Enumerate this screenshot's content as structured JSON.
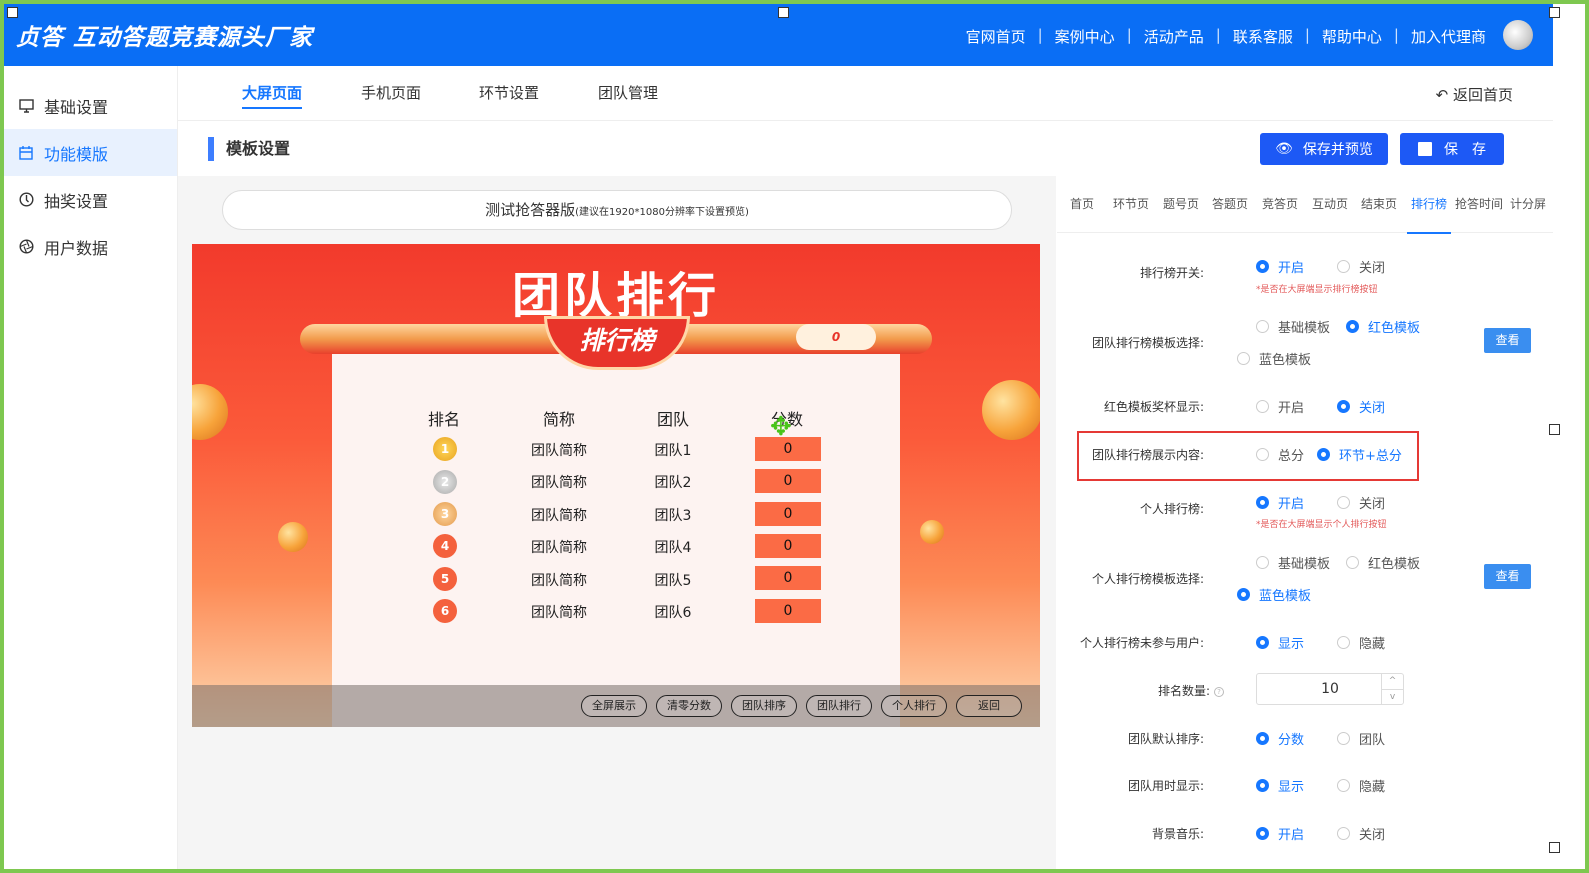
{
  "header": {
    "logo": "贞答 互动答题竞赛源头厂家",
    "nav": [
      "官网首页",
      "案例中心",
      "活动产品",
      "联系客服",
      "帮助中心",
      "加入代理商"
    ]
  },
  "sidebar": {
    "items": [
      {
        "label": "基础设置",
        "icon": "monitor-icon"
      },
      {
        "label": "功能模版",
        "icon": "calendar-icon"
      },
      {
        "label": "抽奖设置",
        "icon": "compass-icon"
      },
      {
        "label": "用户数据",
        "icon": "aperture-icon"
      }
    ]
  },
  "tabs": [
    "大屏页面",
    "手机页面",
    "环节设置",
    "团队管理"
  ],
  "back_label": "返回首页",
  "section_title": "模板设置",
  "buttons": {
    "save_preview": "保存并预览",
    "save": "保　存"
  },
  "preview": {
    "pill": "测试抢答器版",
    "pill_note": "(建议在1920*1080分辨率下设置预览)",
    "title": "团队排行",
    "badge": "排行榜",
    "oval": "0",
    "headers": [
      "排名",
      "简称",
      "团队",
      "分数"
    ],
    "rows": [
      {
        "rank": "1",
        "short": "团队简称",
        "team": "团队1",
        "score": "0"
      },
      {
        "rank": "2",
        "short": "团队简称",
        "team": "团队2",
        "score": "0"
      },
      {
        "rank": "3",
        "short": "团队简称",
        "team": "团队3",
        "score": "0"
      },
      {
        "rank": "4",
        "short": "团队简称",
        "team": "团队4",
        "score": "0"
      },
      {
        "rank": "5",
        "short": "团队简称",
        "team": "团队5",
        "score": "0"
      },
      {
        "rank": "6",
        "short": "团队简称",
        "team": "团队6",
        "score": "0"
      }
    ],
    "bottom_buttons": [
      "全屏展示",
      "清零分数",
      "团队排序",
      "团队排行",
      "个人排行",
      "返回"
    ]
  },
  "right_tabs": [
    "首页",
    "环节页",
    "题号页",
    "答题页",
    "竞答页",
    "互动页",
    "结束页",
    "排行榜",
    "抢答时间",
    "计分屏"
  ],
  "form": {
    "rank_switch": {
      "label": "排行榜开关:",
      "opts": [
        "开启",
        "关闭"
      ],
      "hint": "*是否在大屏端显示排行榜按钮"
    },
    "team_tpl": {
      "label": "团队排行榜模板选择:",
      "opts": [
        "基础模板",
        "红色模板",
        "蓝色模板"
      ],
      "view": "查看"
    },
    "red_cup": {
      "label": "红色模板奖杯显示:",
      "opts": [
        "开启",
        "关闭"
      ]
    },
    "team_content": {
      "label": "团队排行榜展示内容:",
      "opts": [
        "总分",
        "环节+总分"
      ]
    },
    "person_rank": {
      "label": "个人排行榜:",
      "opts": [
        "开启",
        "关闭"
      ],
      "hint": "*是否在大屏端显示个人排行按钮"
    },
    "person_tpl": {
      "label": "个人排行榜模板选择:",
      "opts": [
        "基础模板",
        "红色模板",
        "蓝色模板"
      ],
      "view": "查看"
    },
    "non_user": {
      "label": "个人排行榜未参与用户:",
      "opts": [
        "显示",
        "隐藏"
      ]
    },
    "rank_count": {
      "label": "排名数量:",
      "value": "10",
      "up": "^",
      "down": "v",
      "help": "?"
    },
    "team_sort": {
      "label": "团队默认排序:",
      "opts": [
        "分数",
        "团队"
      ]
    },
    "team_time": {
      "label": "团队用时显示:",
      "opts": [
        "显示",
        "隐藏"
      ]
    },
    "bgm": {
      "label": "背景音乐:",
      "opts": [
        "开启",
        "关闭"
      ]
    }
  },
  "colors": {
    "brand": "#0a6ef5",
    "accent": "#1677ff",
    "highlight": "#e53935"
  }
}
